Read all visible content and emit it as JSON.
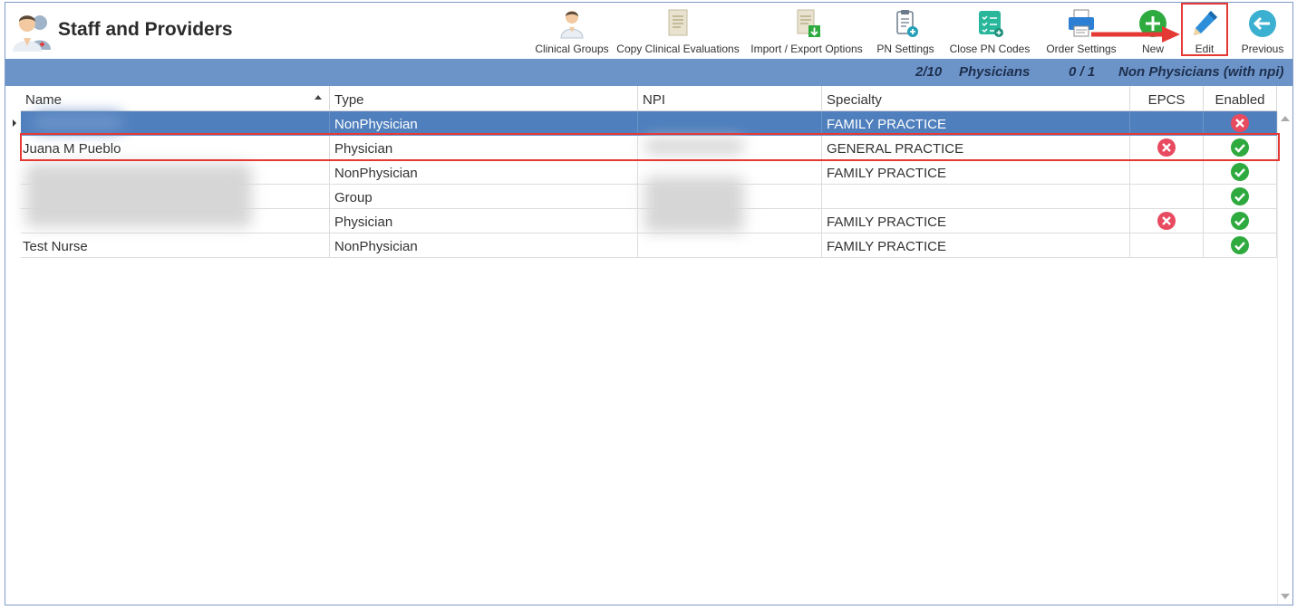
{
  "app": {
    "title": "Staff and Providers"
  },
  "toolbar": {
    "clinical_groups": "Clinical Groups",
    "copy_clinical_evaluations": "Copy Clinical Evaluations",
    "import_export_options": "Import / Export Options",
    "pn_settings": "PN Settings",
    "close_pn_codes": "Close PN Codes",
    "order_settings": "Order Settings",
    "new": "New",
    "edit": "Edit",
    "previous": "Previous"
  },
  "status": {
    "physicians_count": "2/10",
    "physicians_label": "Physicians",
    "nonphysicians_count": "0 / 1",
    "nonphysicians_label": "Non Physicians (with npi)"
  },
  "columns": {
    "name": "Name",
    "type": "Type",
    "npi": "NPI",
    "specialty": "Specialty",
    "epcs": "EPCS",
    "enabled": "Enabled"
  },
  "rows": [
    {
      "name": "",
      "type": "NonPhysician",
      "npi": "",
      "specialty": "FAMILY PRACTICE",
      "epcs": "",
      "enabled": "no",
      "selected": true
    },
    {
      "name": "Juana M Pueblo",
      "type": "Physician",
      "npi": "",
      "specialty": "GENERAL PRACTICE",
      "epcs": "no",
      "enabled": "yes"
    },
    {
      "name": "",
      "type": "NonPhysician",
      "npi": "",
      "specialty": "FAMILY PRACTICE",
      "epcs": "",
      "enabled": "yes"
    },
    {
      "name": "",
      "type": "Group",
      "npi": "",
      "specialty": "",
      "epcs": "",
      "enabled": "yes"
    },
    {
      "name": "",
      "type": "Physician",
      "npi": "",
      "specialty": "FAMILY PRACTICE",
      "epcs": "no",
      "enabled": "yes"
    },
    {
      "name": "Test Nurse",
      "type": "NonPhysician",
      "npi": "",
      "specialty": "FAMILY PRACTICE",
      "epcs": "",
      "enabled": "yes"
    }
  ],
  "colors": {
    "header_bar": "#6d94c9",
    "selected_row": "#4f7fbd",
    "yes": "#2eaa3f",
    "no": "#e84a5f",
    "annotation": "#e53935"
  }
}
